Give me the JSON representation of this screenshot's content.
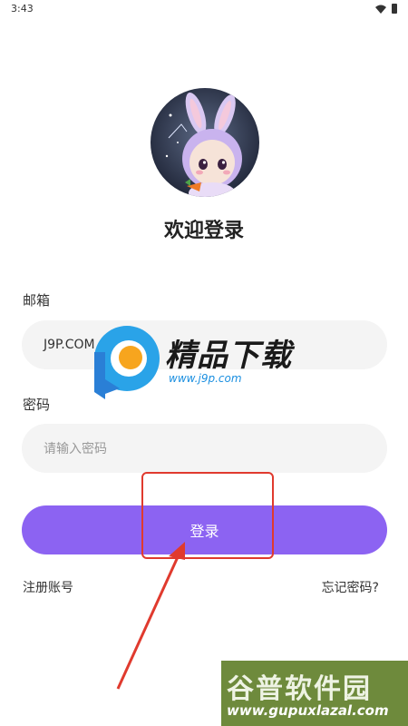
{
  "status_bar": {
    "time": "3:43"
  },
  "page": {
    "title": "欢迎登录"
  },
  "form": {
    "email_label": "邮箱",
    "email_value": "J9P.COM",
    "password_label": "密码",
    "password_placeholder": "请输入密码",
    "login_label": "登录"
  },
  "links": {
    "register": "注册账号",
    "forgot_password": "忘记密码?"
  },
  "watermarks": {
    "j9p_name": "精品下载",
    "j9p_url": "www.j9p.com",
    "gupu_name": "谷普软件园",
    "gupu_url": "www.gupuxlazal.com"
  },
  "colors": {
    "accent": "#8c63f2",
    "input_background": "#f4f4f4",
    "annotation": "#e03a2e"
  },
  "icons": {
    "wifi": "wifi-icon",
    "battery": "battery-icon",
    "avatar": "bunny-avatar"
  }
}
